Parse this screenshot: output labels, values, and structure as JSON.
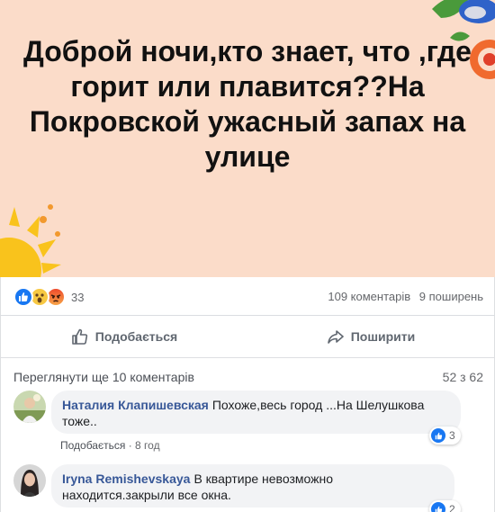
{
  "post": {
    "text": "Доброй ночи,кто знает, что ,где горит или плавится??На Покровской ужасный запах на улице",
    "background_color": "#fbdcc9"
  },
  "summary": {
    "reaction_icons": [
      "like-icon",
      "wow-icon",
      "angry-icon"
    ],
    "reaction_count": "33",
    "comments_count": "109 коментарів",
    "shares_count": "9 поширень"
  },
  "actions": {
    "like_label": "Подобається",
    "share_label": "Поширити"
  },
  "comments": {
    "view_more": "Переглянути ще 10 коментарів",
    "counter": "52 з 62",
    "items": [
      {
        "author": "Наталия Клапишевская",
        "text": "Похоже,весь город ...На Шелушкова тоже..",
        "like_label": "Подобається",
        "time": "8 год",
        "reactions": "3"
      },
      {
        "author": "Iryna Remishevskaya",
        "text": "В квартире невозможно находится.закрыли все окна.",
        "reactions": "2"
      }
    ]
  },
  "colors": {
    "accent": "#1877f2",
    "author_link": "#385898",
    "muted": "#65676b"
  }
}
